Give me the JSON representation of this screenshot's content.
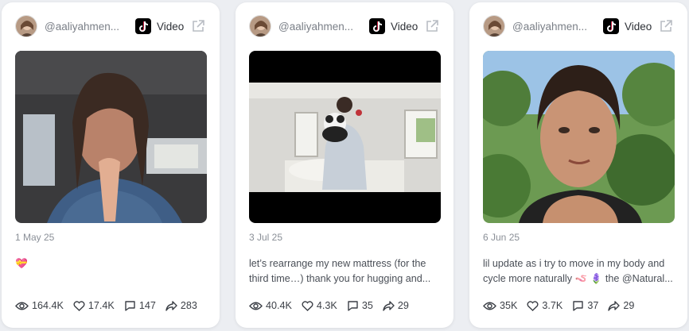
{
  "cards": [
    {
      "handle": "@aaliyahmen...",
      "platform_label": "Video",
      "date": "1 May 25",
      "caption_lines": [
        "💝",
        ""
      ],
      "views": "164.4K",
      "likes": "17.4K",
      "comments": "147",
      "shares": "283"
    },
    {
      "handle": "@aaliyahmen...",
      "platform_label": "Video",
      "date": "3 Jul 25",
      "caption_lines": [
        "let’s rearrange my new mattress (for the",
        "third time…) thank you for hugging and..."
      ],
      "views": "40.4K",
      "likes": "4.3K",
      "comments": "35",
      "shares": "29"
    },
    {
      "handle": "@aaliyahmen...",
      "platform_label": "Video",
      "date": "6 Jun 25",
      "caption_lines": [
        "lil update as i try to move in my body and",
        "cycle more naturally 🪱 🪻 the @Natural..."
      ],
      "views": "35K",
      "likes": "3.7K",
      "comments": "37",
      "shares": "29"
    }
  ],
  "colors": {
    "card_bg": "#ffffff",
    "page_bg": "#eceef2",
    "muted_text": "#8a8f97"
  },
  "icons": [
    "avatar",
    "tiktok-icon",
    "external-link-icon",
    "eye-icon",
    "heart-icon",
    "comment-icon",
    "share-icon"
  ]
}
